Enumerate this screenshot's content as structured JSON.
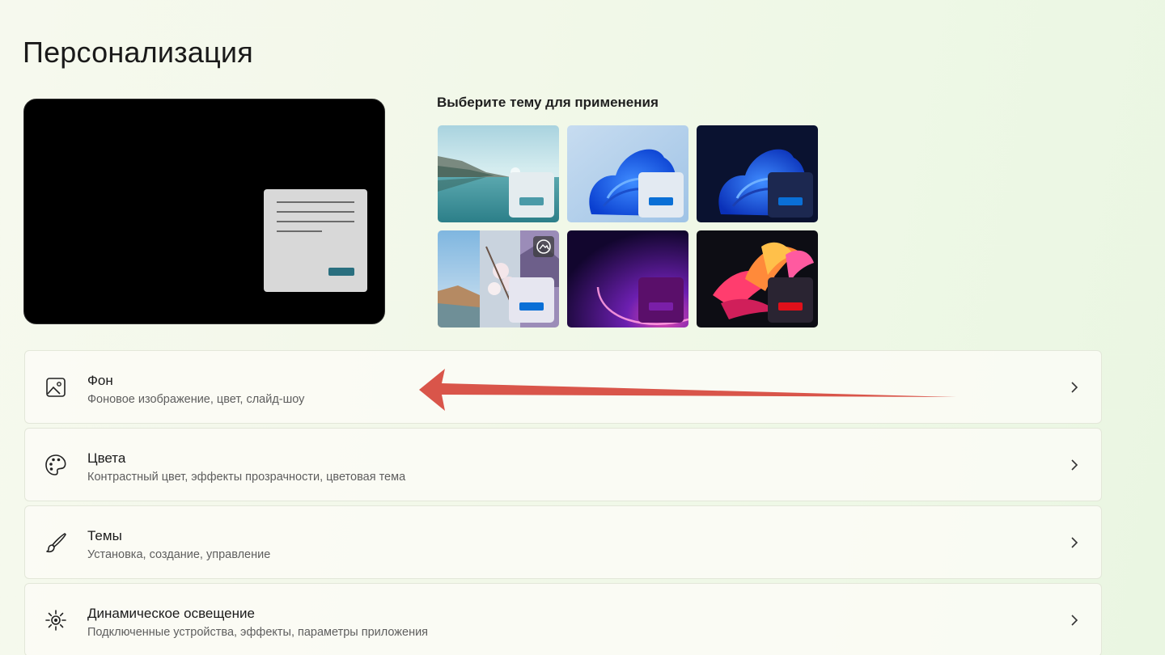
{
  "page": {
    "title": "Персонализация"
  },
  "themes": {
    "heading": "Выберите тему для применения",
    "tiles": [
      {
        "name": "theme-glow-lake",
        "accent": "#4a9aa8"
      },
      {
        "name": "theme-bloom-light",
        "accent": "#0a6fd6"
      },
      {
        "name": "theme-bloom-dark",
        "accent": "#0a6fd6"
      },
      {
        "name": "theme-spotlight-slideshow",
        "accent": "#0a6fd6",
        "icon": "slideshow-icon"
      },
      {
        "name": "theme-glow-purple",
        "accent": "#7a1fa8"
      },
      {
        "name": "theme-flow-red",
        "accent": "#e0101a"
      }
    ]
  },
  "settings": [
    {
      "title": "Фон",
      "subtitle": "Фоновое изображение, цвет, слайд-шоу",
      "icon": "image-icon"
    },
    {
      "title": "Цвета",
      "subtitle": "Контрастный цвет, эффекты прозрачности, цветовая тема",
      "icon": "palette-icon"
    },
    {
      "title": "Темы",
      "subtitle": "Установка, создание, управление",
      "icon": "brush-icon"
    },
    {
      "title": "Динамическое освещение",
      "subtitle": "Подключенные устройства, эффекты, параметры приложения",
      "icon": "lighting-icon"
    }
  ],
  "annotation": {
    "arrow_color": "#d9554a"
  }
}
